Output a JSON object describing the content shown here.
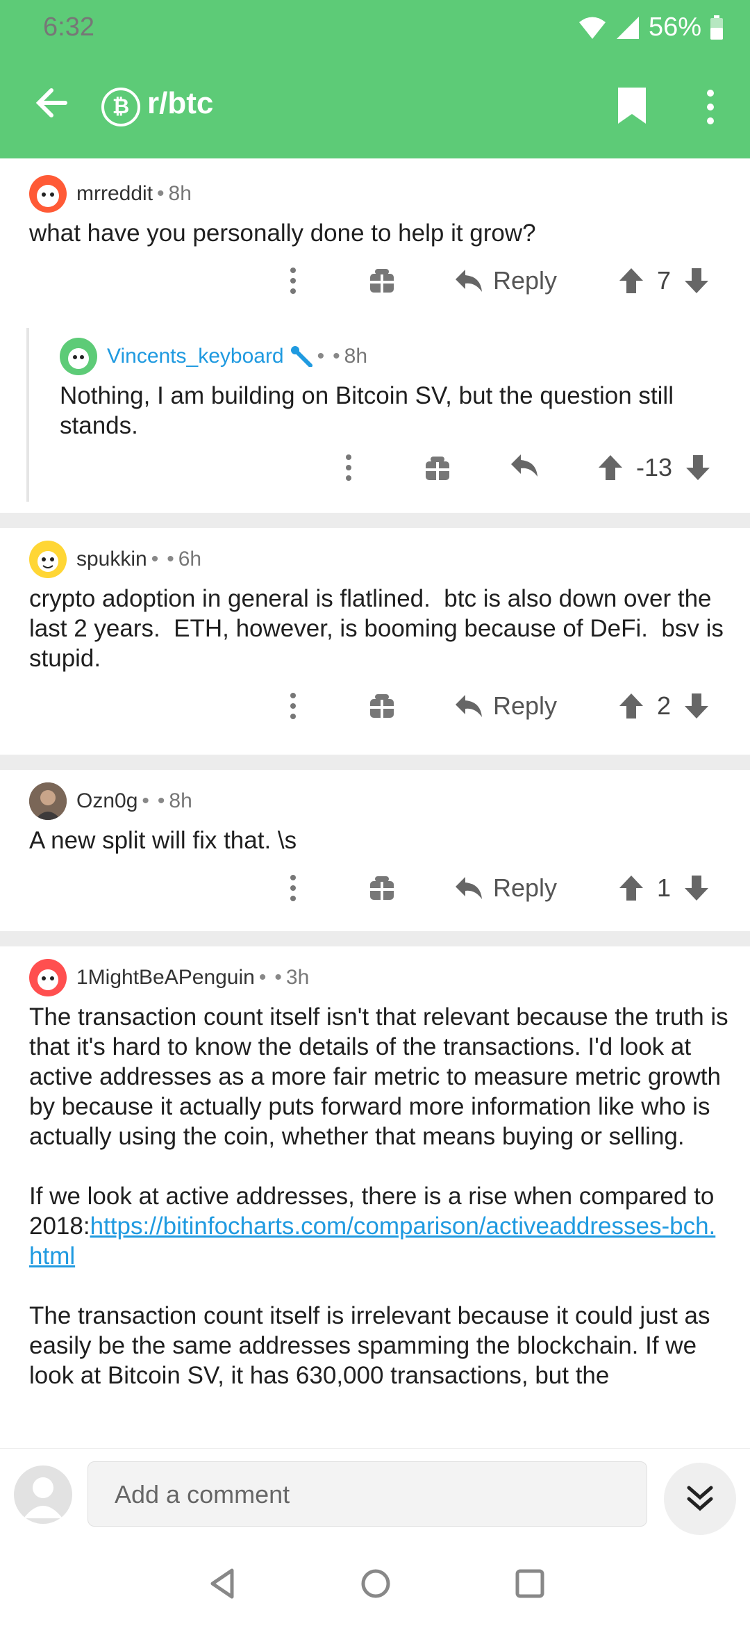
{
  "status": {
    "time": "6:32",
    "battery": "56%"
  },
  "appbar": {
    "subreddit": "r/btc",
    "sub_icon": "₿",
    "icons": [
      "back-arrow-icon",
      "bookmark-icon",
      "overflow-menu-icon"
    ]
  },
  "comments": [
    {
      "username": "mrreddit",
      "sep": "•",
      "time": "8h",
      "text": "what have you personally done to help it grow?",
      "reply": "Reply",
      "score": "7"
    },
    {
      "username": "Vincents_keyboard",
      "sep": "•",
      "sep2": "•",
      "time": "8h",
      "text": "Nothing, I am building on Bitcoin SV, but the question still stands.",
      "score": "-13"
    },
    {
      "username": "spukkin",
      "sep": "•",
      "sep2": "•",
      "time": "6h",
      "text": "crypto adoption in general is flatlined.  btc is also down over the last 2 years.  ETH, however, is booming because of DeFi.  bsv is stupid.",
      "reply": "Reply",
      "score": "2"
    },
    {
      "username": "Ozn0g",
      "sep": "•",
      "sep2": "•",
      "time": "8h",
      "text": "A new split will fix that. \\s",
      "reply": "Reply",
      "score": "1"
    },
    {
      "username": "1MightBeAPenguin",
      "sep": "•",
      "sep2": "•",
      "time": "3h",
      "p1": "The transaction count itself isn't that relevant because the truth is that it's hard to know the details of the transactions. I'd look at active addresses as a more fair metric to measure metric growth by because it actually puts forward more information like who is actually using the coin, whether that means buying or selling.",
      "p2_prefix": "If we look at active addresses, there is a rise when compared to 2018:",
      "p2_link": "https://bitinfocharts.com/comparison/activeaddresses-bch.html",
      "p3": "The transaction count itself is irrelevant because it could just as easily be the same addresses spamming the blockchain. If we look at Bitcoin SV, it has 630,000 transactions, but the"
    }
  ],
  "composer": {
    "placeholder": "Add a comment"
  },
  "colors": {
    "header": "#5dcb77",
    "link": "#1f9ae0"
  }
}
